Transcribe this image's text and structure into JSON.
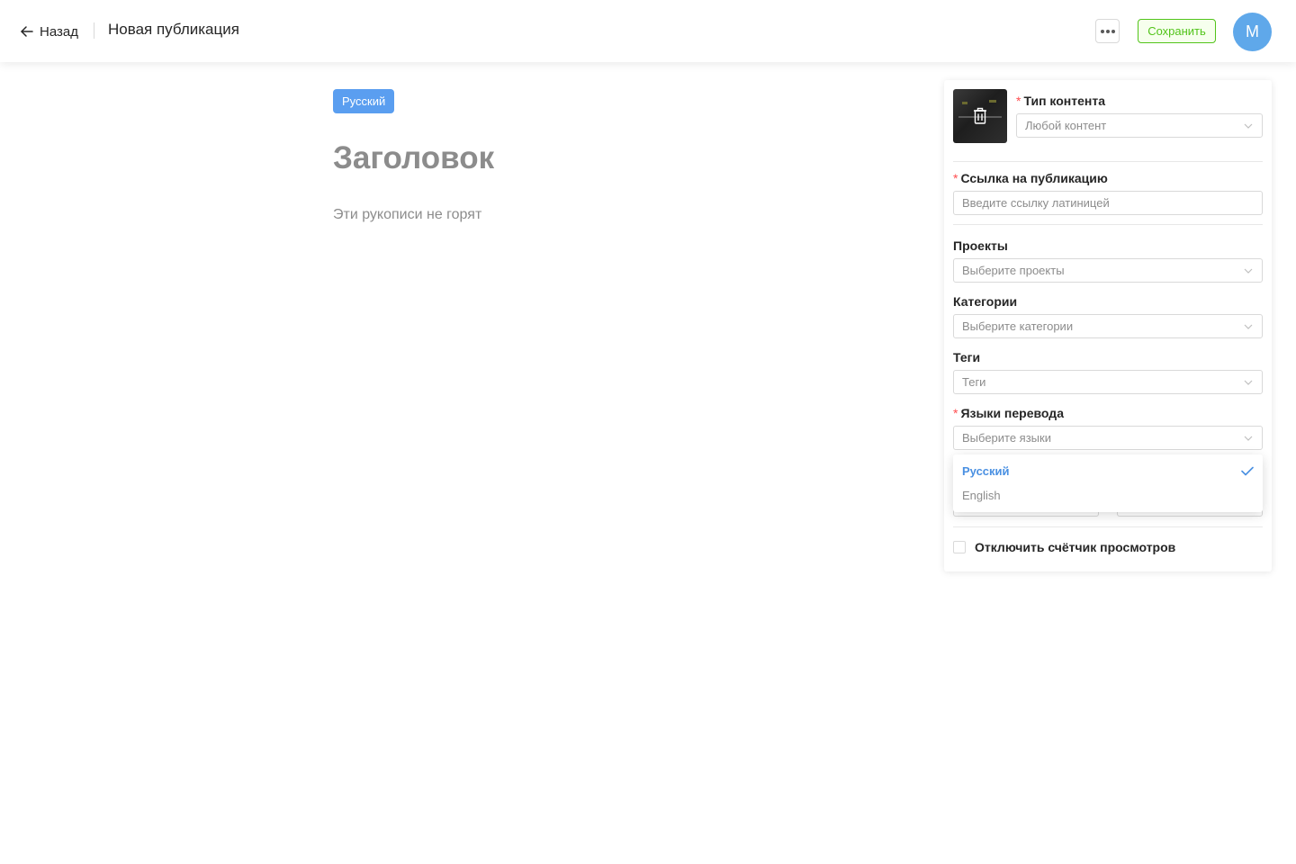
{
  "header": {
    "back_label": "Назад",
    "title": "Новая публикация",
    "save_label": "Сохранить",
    "avatar_initial": "M"
  },
  "editor": {
    "language_tag": "Русский",
    "title_placeholder": "Заголовок",
    "subtitle_placeholder": "Эти рукописи не горят"
  },
  "panel": {
    "content_type": {
      "label": "Тип контента",
      "required": true,
      "value": "Любой контент"
    },
    "link": {
      "label": "Ссылка на публикацию",
      "required": true,
      "placeholder": "Введите ссылку латиницей"
    },
    "projects": {
      "label": "Проекты",
      "placeholder": "Выберите проекты"
    },
    "categories": {
      "label": "Категории",
      "placeholder": "Выберите категории"
    },
    "tags": {
      "label": "Теги",
      "placeholder": "Теги"
    },
    "languages": {
      "label": "Языки перевода",
      "required": true,
      "placeholder": "Выберите языки"
    },
    "disable_counter_label": "Отключить счётчик просмотров",
    "disable_counter_checked": false
  },
  "languages_dropdown": {
    "options": [
      {
        "label": "Русский",
        "selected": true
      },
      {
        "label": "English",
        "selected": false
      }
    ]
  },
  "icons": {
    "back": "arrow-left-icon",
    "more": "more-dots-icon",
    "delete_cover": "trash-icon",
    "chevron": "chevron-down-icon",
    "check": "check-icon"
  },
  "colors": {
    "accent_blue": "#4a90e2",
    "save_green": "#52c41a",
    "avatar_blue": "#5fa8ea",
    "required_red": "#ff4d4f"
  }
}
